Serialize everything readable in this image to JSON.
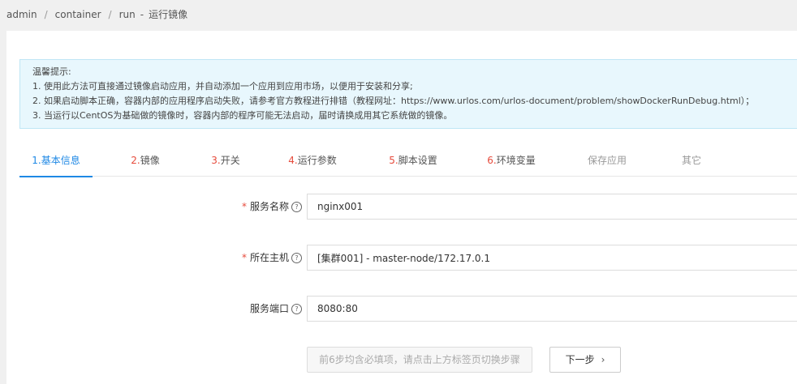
{
  "breadcrumb": {
    "items": [
      "admin",
      "container",
      "run"
    ],
    "separator": "/",
    "current": "运行镜像",
    "dash": "-"
  },
  "tips": {
    "title": "温馨提示:",
    "lines": [
      "1. 使用此方法可直接通过镜像启动应用，并自动添加一个应用到应用市场，以便用于安装和分享;",
      "2. 如果启动脚本正确，容器内部的应用程序启动失败，请参考官方教程进行排错（教程网址：https://www.urlos.com/urlos-document/problem/showDockerRunDebug.html）；",
      "3. 当运行以CentOS为基础做的镜像时，容器内部的程序可能无法启动，届时请换成用其它系统做的镜像。"
    ]
  },
  "tabs": [
    {
      "num": "1.",
      "label": "基本信息"
    },
    {
      "num": "2.",
      "label": "镜像"
    },
    {
      "num": "3.",
      "label": "开关"
    },
    {
      "num": "4.",
      "label": "运行参数"
    },
    {
      "num": "5.",
      "label": "脚本设置"
    },
    {
      "num": "6.",
      "label": "环境变量"
    },
    {
      "num": "",
      "label": "保存应用"
    },
    {
      "num": "",
      "label": "其它"
    }
  ],
  "form": {
    "required_mark": "*",
    "help_glyph": "?",
    "service_name": {
      "label": "服务名称",
      "value": "nginx001"
    },
    "host": {
      "label": "所在主机",
      "value": "[集群001] - master-node/172.17.0.1"
    },
    "port": {
      "label": "服务端口",
      "value": "8080:80"
    }
  },
  "buttons": {
    "hint": "前6步均含必填项，请点击上方标签页切换步骤",
    "next": "下一步",
    "next_glyph": "›"
  },
  "colors": {
    "accent": "#1e88e5",
    "required": "#e64b3c",
    "tips_bg": "#e8f7fd"
  }
}
